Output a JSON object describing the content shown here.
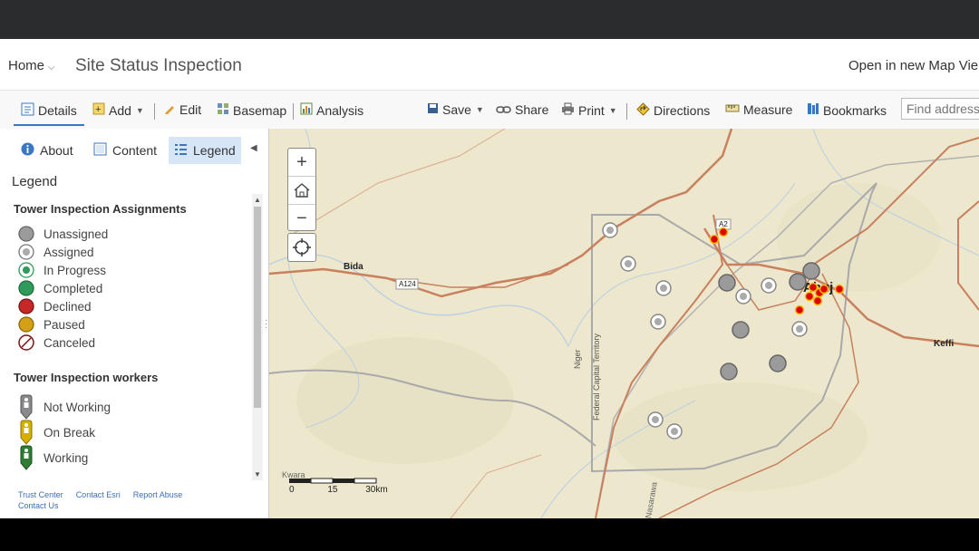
{
  "header": {
    "home_label": "Home",
    "title": "Site Status Inspection",
    "open_map_label": "Open in new Map Vie"
  },
  "toolbar": {
    "details": "Details",
    "add": "Add",
    "edit": "Edit",
    "basemap": "Basemap",
    "analysis": "Analysis",
    "save": "Save",
    "share": "Share",
    "print": "Print",
    "directions": "Directions",
    "measure": "Measure",
    "bookmarks": "Bookmarks",
    "find_placeholder": "Find address"
  },
  "sidebar": {
    "tabs": {
      "about": "About",
      "content": "Content",
      "legend": "Legend"
    },
    "legend_heading": "Legend",
    "assignments_title": "Tower Inspection Assignments",
    "assignments": [
      "Unassigned",
      "Assigned",
      "In Progress",
      "Completed",
      "Declined",
      "Paused",
      "Canceled"
    ],
    "workers_title": "Tower Inspection workers",
    "workers": [
      "Not Working",
      "On Break",
      "Working"
    ],
    "footer": {
      "trust": "Trust Center",
      "contact": "Contact Esri",
      "report": "Report Abuse",
      "contact_us": "Contact Us"
    }
  },
  "map": {
    "labels": {
      "bida": "Bida",
      "a124": "A124",
      "a2": "A2",
      "abuja": "Abuj",
      "keffi": "Keffi",
      "niger": "Niger",
      "fct": "Federal Capital Territory",
      "kwara": "Kwara",
      "nasarawa": "Nasarawa"
    },
    "scale": {
      "zero": "0",
      "mid": "15",
      "end": "30km"
    }
  },
  "colors": {
    "unassigned": "#9b9b9b",
    "in_progress": "#2e9a5b",
    "completed": "#2e9a5b",
    "declined": "#c62828",
    "paused": "#d4a017",
    "road": "#c8805e",
    "worker_active": "#e00000",
    "accent": "#3a76c4"
  }
}
